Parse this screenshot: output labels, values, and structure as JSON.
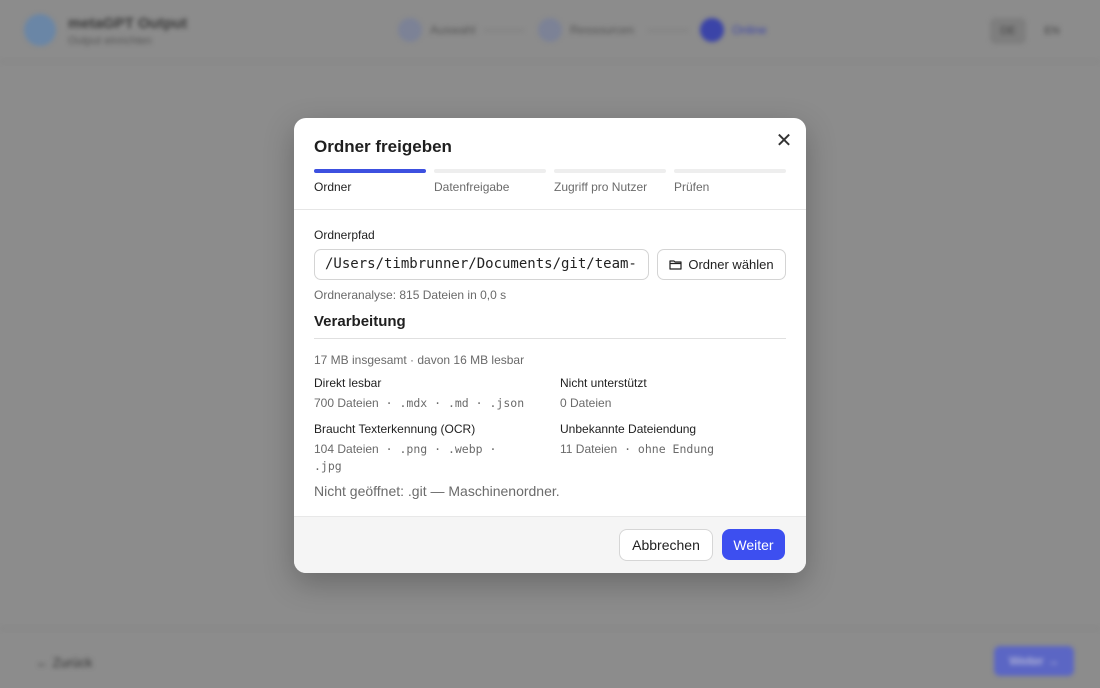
{
  "background_app": {
    "title": "metaGPT Output",
    "subtitle": "Output einrichten",
    "steps": [
      "Auswahl",
      "Ressourcen",
      "Online"
    ],
    "lang": [
      "DE",
      "EN"
    ],
    "back_label": "← Zurück",
    "next_label": "Weiter →"
  },
  "modal": {
    "title": "Ordner freigeben",
    "close_icon": "close-icon",
    "steps": [
      {
        "label": "Ordner",
        "active": true
      },
      {
        "label": "Datenfreigabe",
        "active": false
      },
      {
        "label": "Zugriff pro Nutzer",
        "active": false
      },
      {
        "label": "Prüfen",
        "active": false
      }
    ],
    "path_label": "Ordnerpfad",
    "path_value": "/Users/timbrunner/Documents/git/team-",
    "choose_button": "Ordner wählen",
    "analysis": "Ordneranalyse: 815 Dateien in 0,0 s",
    "section_title": "Verarbeitung",
    "total": "17 MB insgesamt · davon 16 MB lesbar",
    "categories": [
      {
        "title": "Direkt lesbar",
        "count": "700 Dateien",
        "ext": " · .mdx · .md · .json"
      },
      {
        "title": "Nicht unterstützt",
        "count": "0 Dateien",
        "ext": ""
      },
      {
        "title": "Braucht Texterkennung (OCR)",
        "count": "104 Dateien",
        "ext": " · .png · .webp · .jpg"
      },
      {
        "title": "Unbekannte Dateiendung",
        "count": "11 Dateien",
        "ext": " · ohne Endung"
      }
    ],
    "note": "Nicht geöffnet: .git — Maschinenordner.",
    "cancel_button": "Abbrechen",
    "next_button": "Weiter"
  },
  "colors": {
    "accent": "#3d4ff0",
    "overlay": "#8c8c8c"
  }
}
